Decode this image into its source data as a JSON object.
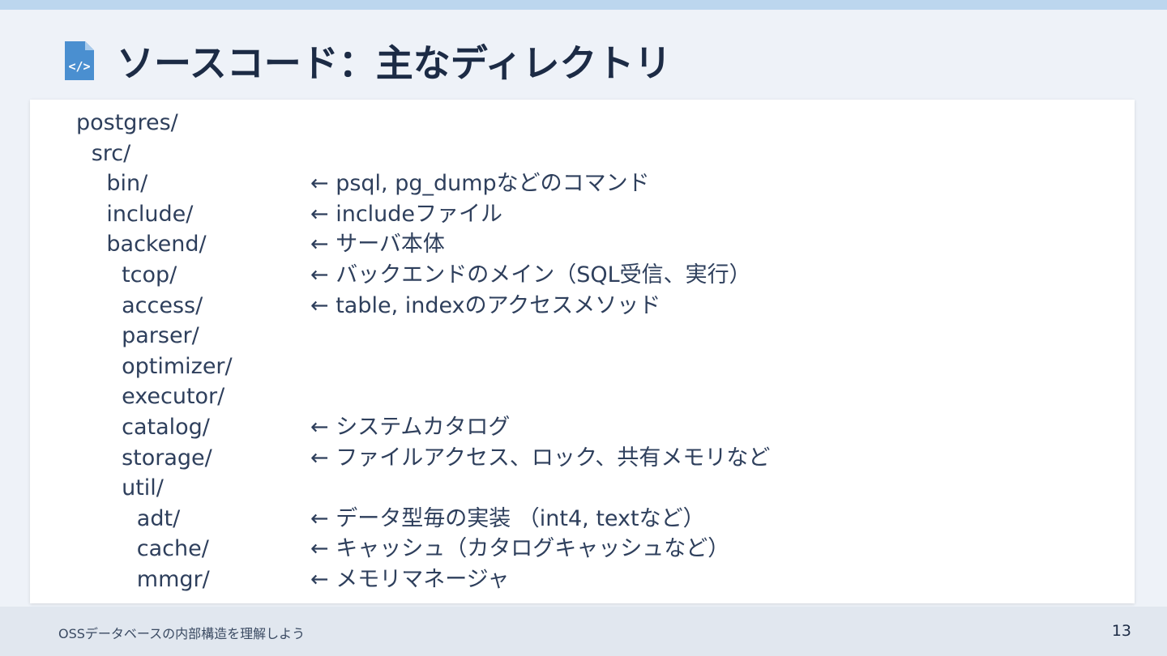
{
  "slide": {
    "title": "ソースコード：主なディレクトリ",
    "title_icon": "code-file-icon",
    "accent_color": "#4a8fd0",
    "tree": [
      {
        "path": "postgres/",
        "depth": 0,
        "note": ""
      },
      {
        "path": "src/",
        "depth": 1,
        "note": ""
      },
      {
        "path": "bin/",
        "depth": 2,
        "note": "← psql, pg_dumpなどのコマンド"
      },
      {
        "path": "include/",
        "depth": 2,
        "note": "← includeファイル"
      },
      {
        "path": "backend/",
        "depth": 2,
        "note": "← サーバ本体"
      },
      {
        "path": "tcop/",
        "depth": 3,
        "note": "← バックエンドのメイン（SQL受信、実行）"
      },
      {
        "path": "access/",
        "depth": 3,
        "note": "← table, indexのアクセスメソッド"
      },
      {
        "path": "parser/",
        "depth": 3,
        "note": ""
      },
      {
        "path": "optimizer/",
        "depth": 3,
        "note": ""
      },
      {
        "path": "executor/",
        "depth": 3,
        "note": ""
      },
      {
        "path": "catalog/",
        "depth": 3,
        "note": "← システムカタログ"
      },
      {
        "path": "storage/",
        "depth": 3,
        "note": "← ファイルアクセス、ロック、共有メモリなど"
      },
      {
        "path": "util/",
        "depth": 3,
        "note": ""
      },
      {
        "path": "adt/",
        "depth": 4,
        "note": "← データ型毎の実装 （int4, textなど）"
      },
      {
        "path": "cache/",
        "depth": 4,
        "note": "← キャッシュ（カタログキャッシュなど）"
      },
      {
        "path": "mmgr/",
        "depth": 4,
        "note": "← メモリマネージャ"
      }
    ]
  },
  "footer": {
    "text": "OSSデータベースの内部構造を理解しよう",
    "page_number": "13"
  }
}
